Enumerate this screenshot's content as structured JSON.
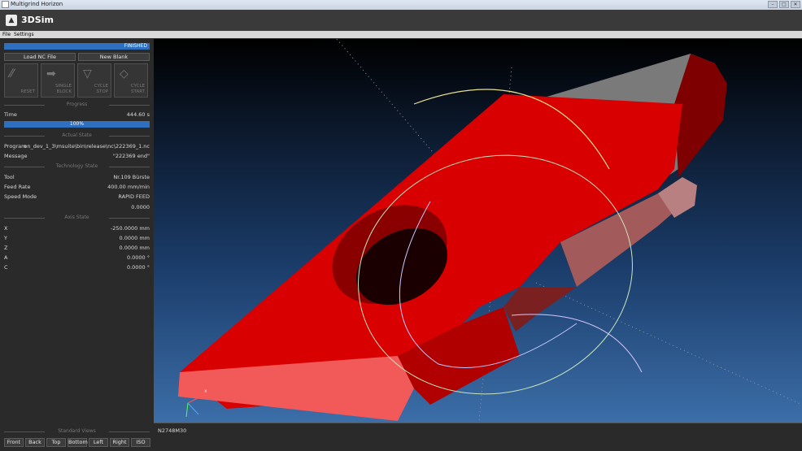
{
  "window": {
    "title": "Multigrind Horizon",
    "controls": [
      "–",
      "□",
      "✕"
    ]
  },
  "app": {
    "name": "3DSim"
  },
  "menu": [
    {
      "label": "File"
    },
    {
      "label": "Settings"
    }
  ],
  "status": "FINISHED",
  "buttons": {
    "load_nc": "Load NC File",
    "new_blank": "New Blank"
  },
  "controls": [
    {
      "label": "RESET",
      "icon": "reset-icon"
    },
    {
      "label": "SINGLE\nBLOCK",
      "icon": "single-block-icon"
    },
    {
      "label": "CYCLE\nSTOP",
      "icon": "cycle-stop-icon"
    },
    {
      "label": "CYCLE\nSTART",
      "icon": "cycle-start-icon"
    }
  ],
  "progress_section": {
    "title": "Progress",
    "time_label": "Time",
    "time_value": "444.60 s",
    "percent_label": "100%",
    "fraction": 1.0
  },
  "actual_state": {
    "title": "Actual State",
    "program_label": "Program",
    "program_value": "on_dev_1_3\\msuite\\bin\\release\\nc\\222369_1.nc",
    "message_label": "Message",
    "message_value": "\"222369 end\""
  },
  "technology_state": {
    "title": "Technology State",
    "tool_label": "Tool",
    "tool_value": "Nr.109 Bürste",
    "feed_label": "Feed Rate",
    "feed_value": "400.00 mm/min",
    "speed_label": "Speed Mode",
    "speed_value": "RAPID FEED",
    "extra_value": "0.0000"
  },
  "axis_state": {
    "title": "Axis State",
    "axes": [
      {
        "name": "X",
        "value": "-250.0000 mm"
      },
      {
        "name": "Y",
        "value": "0.0000 mm"
      },
      {
        "name": "Z",
        "value": "0.0000 mm"
      },
      {
        "name": "A",
        "value": "0.0000 °"
      },
      {
        "name": "C",
        "value": "0.0000 °"
      }
    ]
  },
  "standard_views": {
    "title": "Standard Views",
    "views": [
      "Front",
      "Back",
      "Top",
      "Bottom",
      "Left",
      "Right",
      "ISO"
    ]
  },
  "viewport": {
    "axis_label": "x"
  },
  "console": {
    "line": "N2748M30"
  }
}
